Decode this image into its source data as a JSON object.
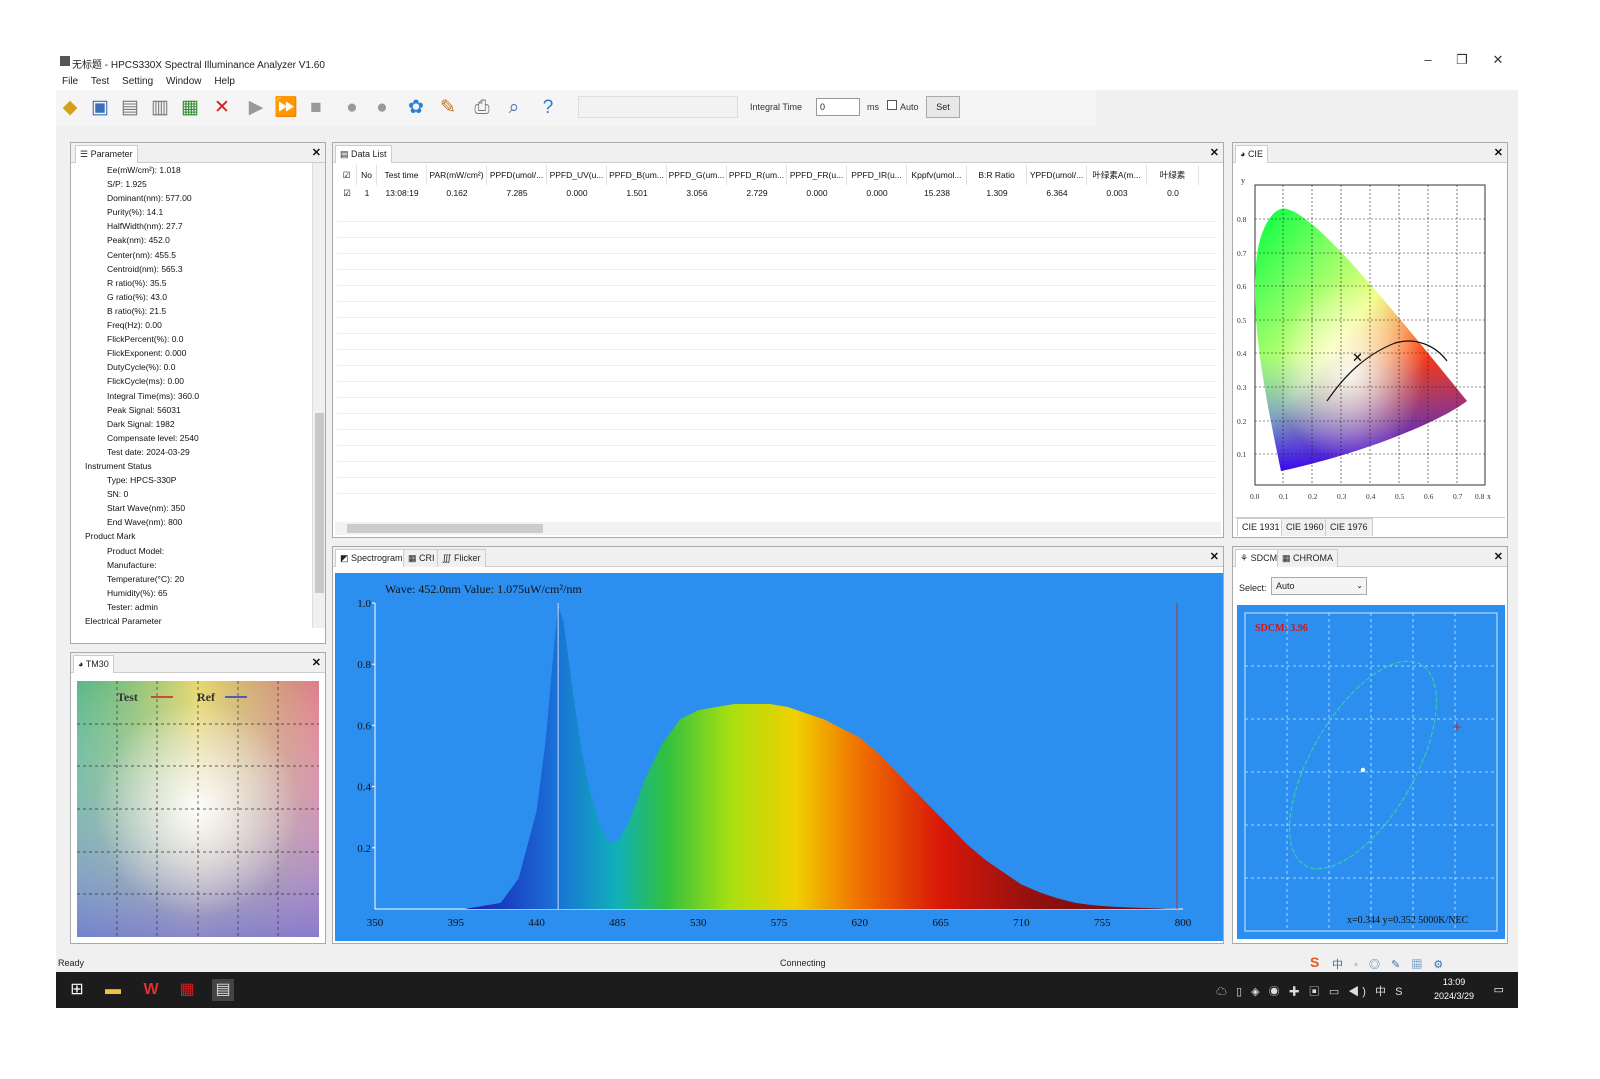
{
  "window": {
    "title": "无标题 - HPCS330X Spectral Illuminance Analyzer V1.60",
    "minimize": "–",
    "restore": "❐",
    "close": "✕"
  },
  "menu": [
    "File",
    "Test",
    "Setting",
    "Window",
    "Help"
  ],
  "toolbar": {
    "integral_time_label": "Integral Time",
    "integral_time_value": "0",
    "ms_label": "ms",
    "auto_label": "Auto",
    "set_label": "Set"
  },
  "parameter_panel": {
    "tab": "Parameter",
    "items": [
      "Ee(mW/cm²): 1.018",
      "S/P: 1.925",
      "Dominant(nm): 577.00",
      "Purity(%): 14.1",
      "HalfWidth(nm): 27.7",
      "Peak(nm): 452.0",
      "Center(nm): 455.5",
      "Centroid(nm): 565.3",
      "R ratio(%): 35.5",
      "G ratio(%): 43.0",
      "B ratio(%): 21.5",
      "Freq(Hz): 0.00",
      "FlickPercent(%): 0.0",
      "FlickExponent: 0.000",
      "DutyCycle(%): 0.0",
      "FlickCycle(ms): 0.00",
      "Integral Time(ms): 360.0",
      "Peak Signal: 56031",
      "Dark Signal: 1982",
      "Compensate level: 2540",
      "Test date: 2024-03-29",
      "Instrument Status",
      "Type: HPCS-330P",
      "SN: 0",
      "Start Wave(nm): 350",
      "End Wave(nm): 800",
      "Product Mark",
      "Product Model:",
      "Manufacture:",
      "Temperature(°C): 20",
      "Humidity(%): 65",
      "Tester: admin",
      "Electrical Parameter"
    ]
  },
  "data_list": {
    "tab": "Data List",
    "headers": [
      "No",
      "Test time",
      "PAR(mW/cm²)",
      "PPFD(umol/...",
      "PPFD_UV(u...",
      "PPFD_B(um...",
      "PPFD_G(um...",
      "PPFD_R(um...",
      "PPFD_FR(u...",
      "PPFD_IR(u...",
      "Kppfv(umol...",
      "B:R Ratio",
      "YPFD(umol/...",
      "叶绿素A(m...",
      "叶绿素"
    ],
    "row": [
      "1",
      "13:08:19",
      "0.162",
      "7.285",
      "0.000",
      "1.501",
      "3.056",
      "2.729",
      "0.000",
      "0.000",
      "15.238",
      "1.309",
      "6.364",
      "0.003",
      "0.0"
    ]
  },
  "cie_panel": {
    "tab": "CIE",
    "y_axis_label": "y",
    "x_axis_label": "x",
    "ticks": [
      "0.0",
      "0.1",
      "0.2",
      "0.3",
      "0.4",
      "0.5",
      "0.6",
      "0.7",
      "0.8"
    ],
    "tabs": [
      "CIE 1931",
      "CIE 1960",
      "CIE 1976"
    ]
  },
  "tm30_panel": {
    "tab": "TM30",
    "legend_test": "Test",
    "legend_ref": "Ref"
  },
  "spectrum_panel": {
    "tabs": [
      "Spectrogram",
      "CRI",
      "Flicker"
    ],
    "readout": "Wave: 452.0nm Value: 1.075uW/cm²/nm"
  },
  "sdcm_panel": {
    "tabs": [
      "SDCM",
      "CHROMA"
    ],
    "select_label": "Select:",
    "select_value": "Auto",
    "sdcm_value": "SDCM: 3.96",
    "coords": "x=0.344 y=0.352 5000K/NEC"
  },
  "status": {
    "left": "Ready",
    "center": "Connecting"
  },
  "taskbar": {
    "time": "13:09",
    "date": "2024/3/29"
  },
  "chart_data": {
    "type": "area",
    "title": "",
    "xlabel": "",
    "ylabel": "",
    "xlim": [
      350,
      800
    ],
    "ylim": [
      0,
      1.0
    ],
    "x_ticks": [
      350,
      395,
      440,
      485,
      530,
      575,
      620,
      665,
      710,
      755,
      800
    ],
    "y_ticks": [
      0.2,
      0.4,
      0.6,
      0.8,
      1.0
    ],
    "grid": false,
    "cursor_x": 452,
    "x": [
      350,
      400,
      420,
      430,
      440,
      445,
      450,
      452,
      455,
      460,
      465,
      470,
      475,
      480,
      485,
      490,
      495,
      500,
      510,
      520,
      530,
      540,
      550,
      560,
      570,
      580,
      590,
      600,
      610,
      620,
      630,
      640,
      650,
      660,
      670,
      680,
      690,
      700,
      710,
      720,
      730,
      740,
      750,
      760,
      770,
      780,
      790,
      800
    ],
    "values": [
      0,
      0,
      0.02,
      0.1,
      0.32,
      0.55,
      0.88,
      0.99,
      0.94,
      0.72,
      0.52,
      0.38,
      0.28,
      0.22,
      0.22,
      0.27,
      0.34,
      0.42,
      0.54,
      0.62,
      0.65,
      0.66,
      0.67,
      0.67,
      0.67,
      0.66,
      0.64,
      0.62,
      0.59,
      0.56,
      0.51,
      0.45,
      0.39,
      0.33,
      0.27,
      0.21,
      0.16,
      0.12,
      0.08,
      0.055,
      0.035,
      0.02,
      0.012,
      0.008,
      0.005,
      0.003,
      0.001,
      0
    ]
  }
}
